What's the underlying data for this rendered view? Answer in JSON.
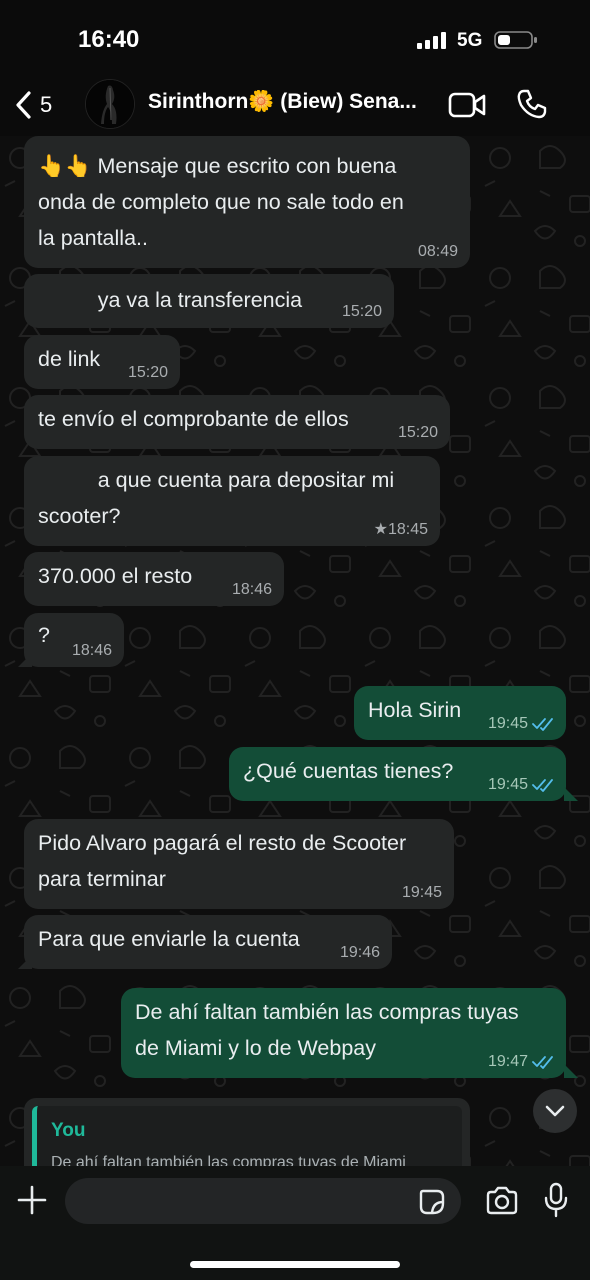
{
  "status": {
    "time": "16:40",
    "network": "5G"
  },
  "header": {
    "back_count": "5",
    "contact_name": "Sirinthorn🌼 (Biew) Sena..."
  },
  "messages": [
    {
      "dir": "in",
      "text": "👆👆 Mensaje que escrito con buena\nonda de completo que no sale todo en\nla pantalla..",
      "time": "08:49"
    },
    {
      "dir": "in",
      "text": "          ya va la transferencia",
      "time": "15:20"
    },
    {
      "dir": "in",
      "text": "de link",
      "time": "15:20"
    },
    {
      "dir": "in",
      "text": "te envío el comprobante de ellos",
      "time": "15:20"
    },
    {
      "dir": "in",
      "text": "          a que cuenta para depositar mi\nscooter?",
      "time": "★18:45"
    },
    {
      "dir": "in",
      "text": "370.000 el resto",
      "time": "18:46"
    },
    {
      "dir": "in",
      "text": "?",
      "time": "18:46"
    },
    {
      "dir": "out",
      "text": "Hola Sirin",
      "time": "19:45"
    },
    {
      "dir": "out",
      "text": "¿Qué cuentas tienes?",
      "time": "19:45"
    },
    {
      "dir": "in",
      "text": "Pido Alvaro pagará el resto de Scooter\npara terminar",
      "time": "19:45"
    },
    {
      "dir": "in",
      "text": "Para que enviarle la cuenta",
      "time": "19:46"
    },
    {
      "dir": "out",
      "text": "De ahí faltan también las compras tuyas\nde Miami y lo de Webpay",
      "time": "19:47"
    }
  ],
  "reply": {
    "author": "You",
    "text": "De ahí faltan también las compras tuyas de Miami"
  },
  "input": {
    "placeholder": ""
  },
  "colors": {
    "incoming": "#242626",
    "outgoing": "#134d37",
    "read_ticks": "#53bdeb",
    "accent": "#1fb99a"
  }
}
